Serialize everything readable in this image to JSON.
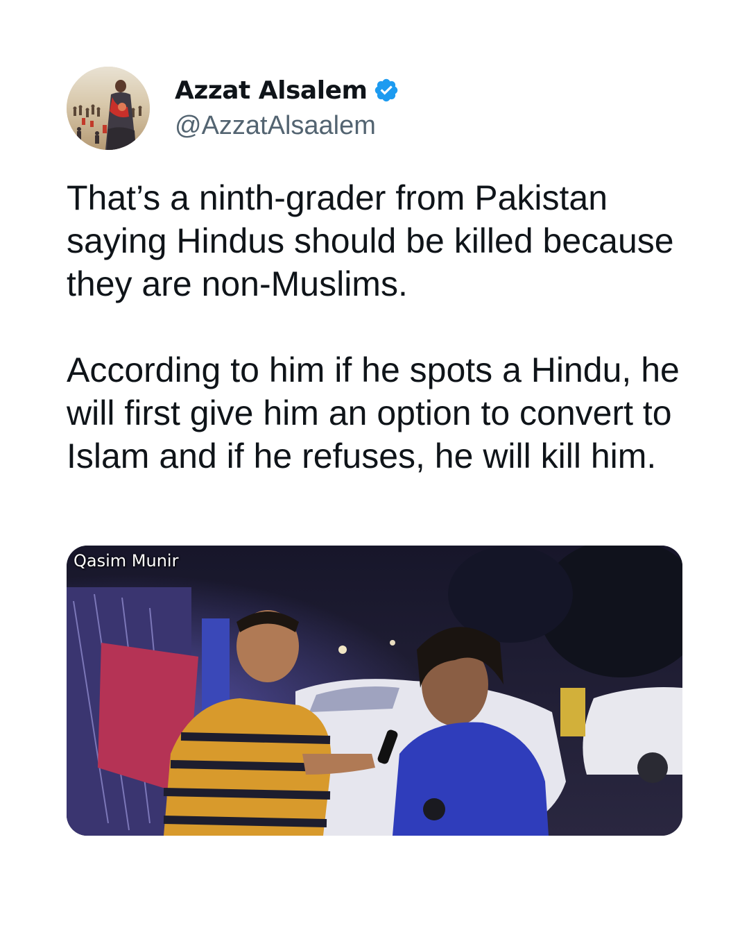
{
  "author": {
    "display_name": "Azzat Alsalem",
    "handle": "@AzzatAlsaalem",
    "verified": true,
    "verified_icon": "verified-badge-icon",
    "verified_color": "#1d9bf0"
  },
  "tweet": {
    "paragraphs": [
      "That’s a ninth-grader from Pakistan saying Hindus should be killed because they are non-Muslims.",
      "According to him if he spots a Hindu, he will first give him an option to convert to Islam and if he refuses, he will kill him."
    ]
  },
  "media": {
    "watermark": "Qasim Munir"
  },
  "colors": {
    "text": "#0f1419",
    "secondary_text": "#536471",
    "background": "#ffffff"
  }
}
